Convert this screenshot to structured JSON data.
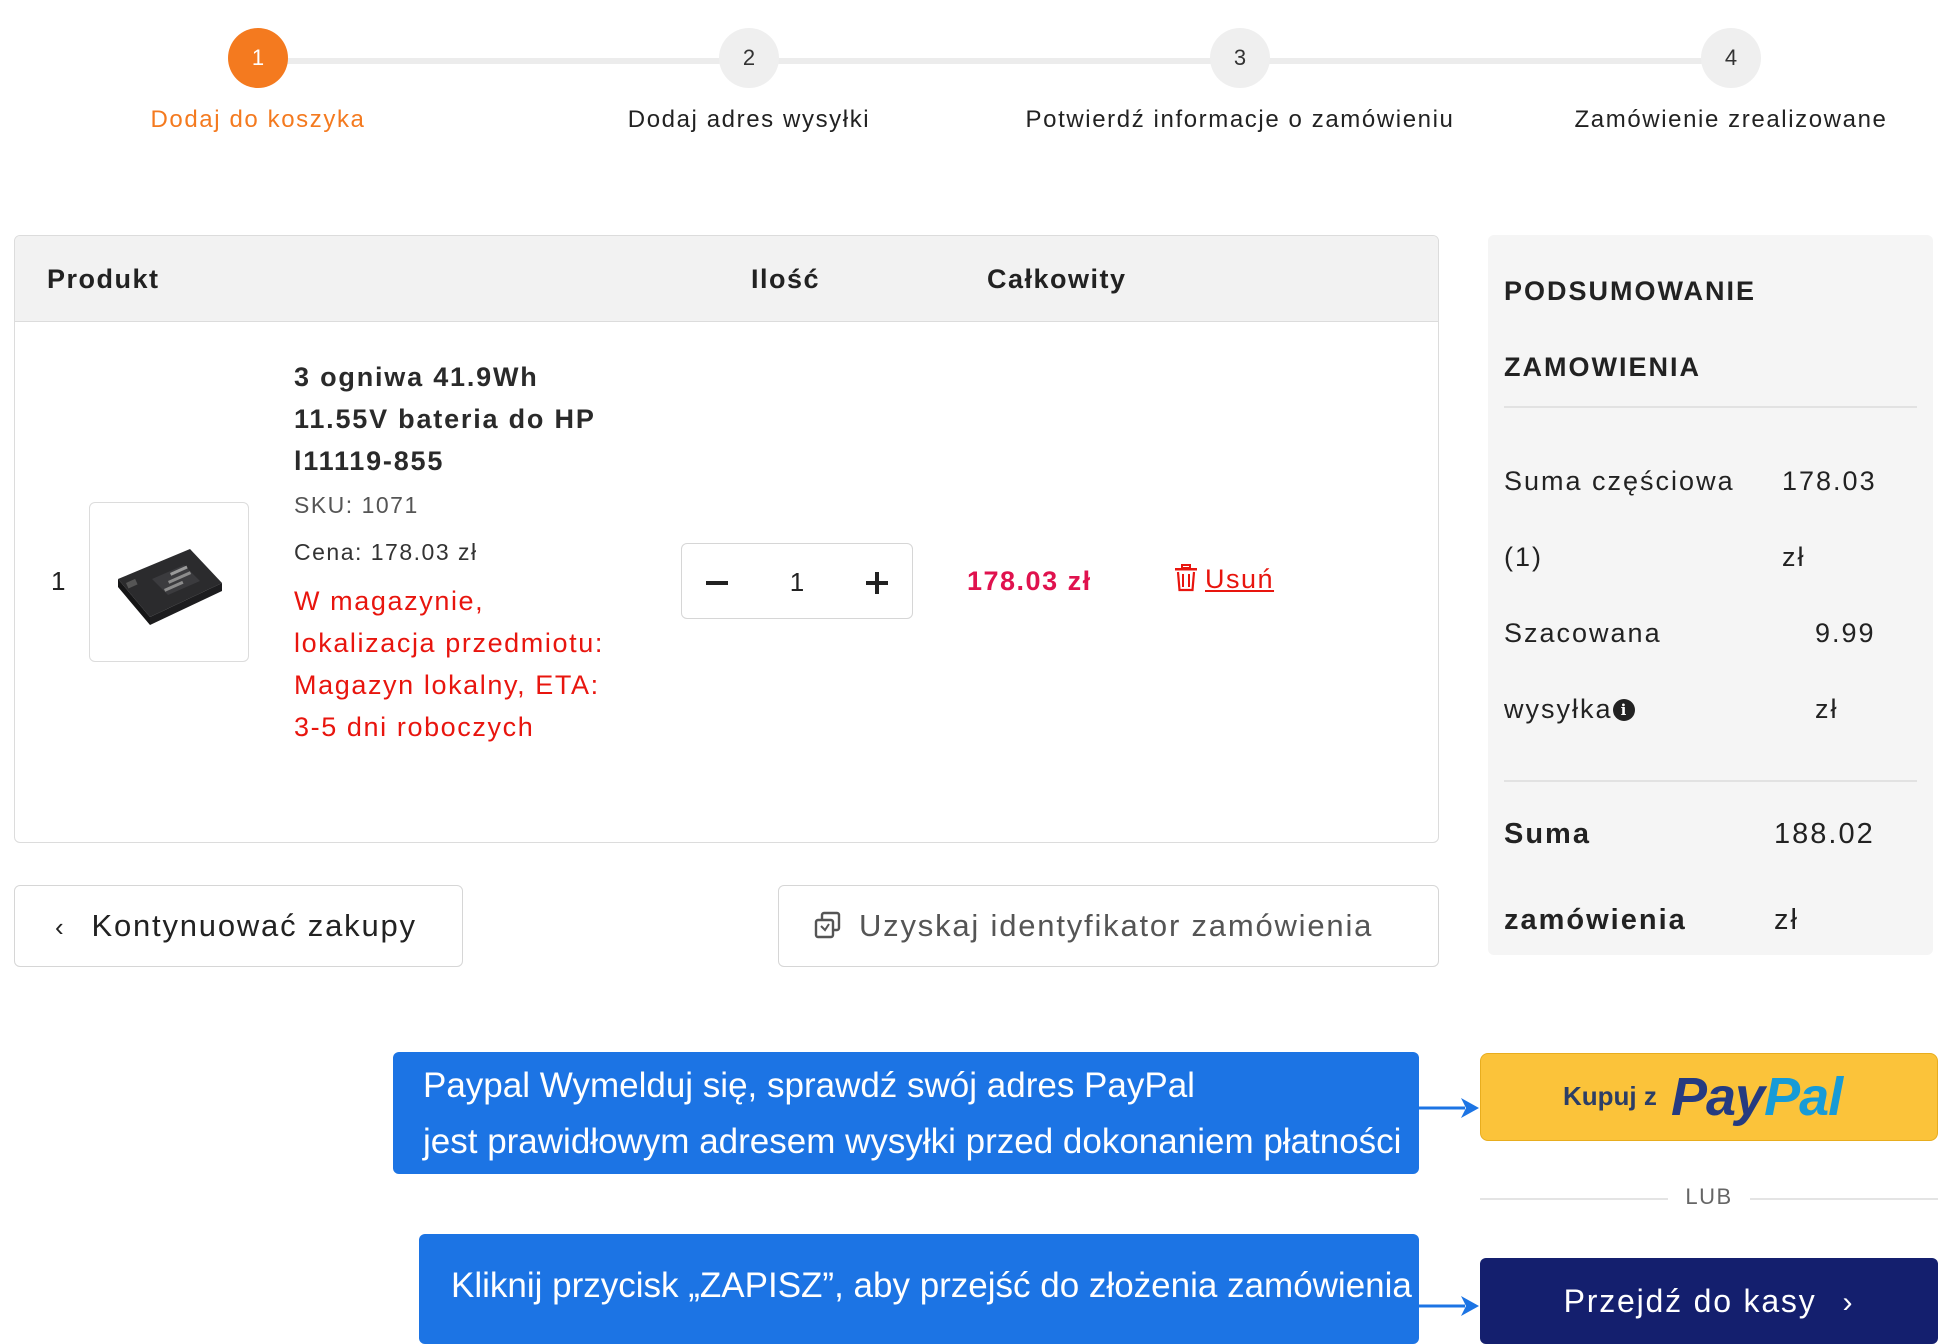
{
  "steps": [
    {
      "number": "1",
      "label": "Dodaj do koszyka",
      "active": true
    },
    {
      "number": "2",
      "label": "Dodaj adres wysyłki",
      "active": false
    },
    {
      "number": "3",
      "label": "Potwierdź informacje o zamówieniu",
      "active": false
    },
    {
      "number": "4",
      "label": "Zamówienie zrealizowane",
      "active": false
    }
  ],
  "cart": {
    "headers": {
      "product": "Produkt",
      "quantity": "Ilość",
      "total": "Całkowity"
    },
    "item": {
      "index": "1",
      "title": "3 ogniwa 41.9Wh 11.55V bateria do HP l11119-855",
      "sku": "SKU: 1071",
      "price": "Cena: 178.03 zł",
      "stock": "W magazynie, lokalizacja przedmiotu: Magazyn lokalny, ETA: 3-5 dni roboczych",
      "quantity": "1",
      "total": "178.03 zł",
      "remove_label": "Usuń"
    }
  },
  "actions": {
    "continue_label": "Kontynuować zakupy",
    "order_id_label": "Uzyskaj identyfikator zamówienia"
  },
  "summary": {
    "title": "PODSUMOWANIE ZAMOWIENIA",
    "subtotal_label": "Suma częściowa (1)",
    "subtotal_value": "178.03 zł",
    "shipping_label": "Szacowana wysyłka",
    "shipping_value": "9.99 zł",
    "total_label": "Suma zamówienia",
    "total_value": "188.02 zł"
  },
  "annotations": {
    "paypal_note_line1": "Paypal Wymelduj się, sprawdź swój adres PayPal",
    "paypal_note_line2": "jest prawidłowym adresem wysyłki przed dokonaniem płatności",
    "checkout_note": "Kliknij przycisk „ZAPISZ”, aby przejść do złożenia zamówienia"
  },
  "payment": {
    "paypal_prefix": "Kupuj z",
    "paypal_brand_pay": "Pay",
    "paypal_brand_pal": "Pal",
    "or_label": "LUB",
    "checkout_label": "Przejdź do kasy"
  },
  "colors": {
    "accent": "#f47a1f",
    "price": "#e0124e",
    "stock": "#e8150e",
    "callout": "#1c74e4",
    "paypal": "#fbc33a",
    "checkout": "#141f6e"
  },
  "icons": {
    "continue": "chevron-left-icon",
    "order_id": "copy-icon",
    "remove": "trash-icon",
    "shipping_info": "info-icon",
    "checkout": "chevron-right-icon"
  }
}
